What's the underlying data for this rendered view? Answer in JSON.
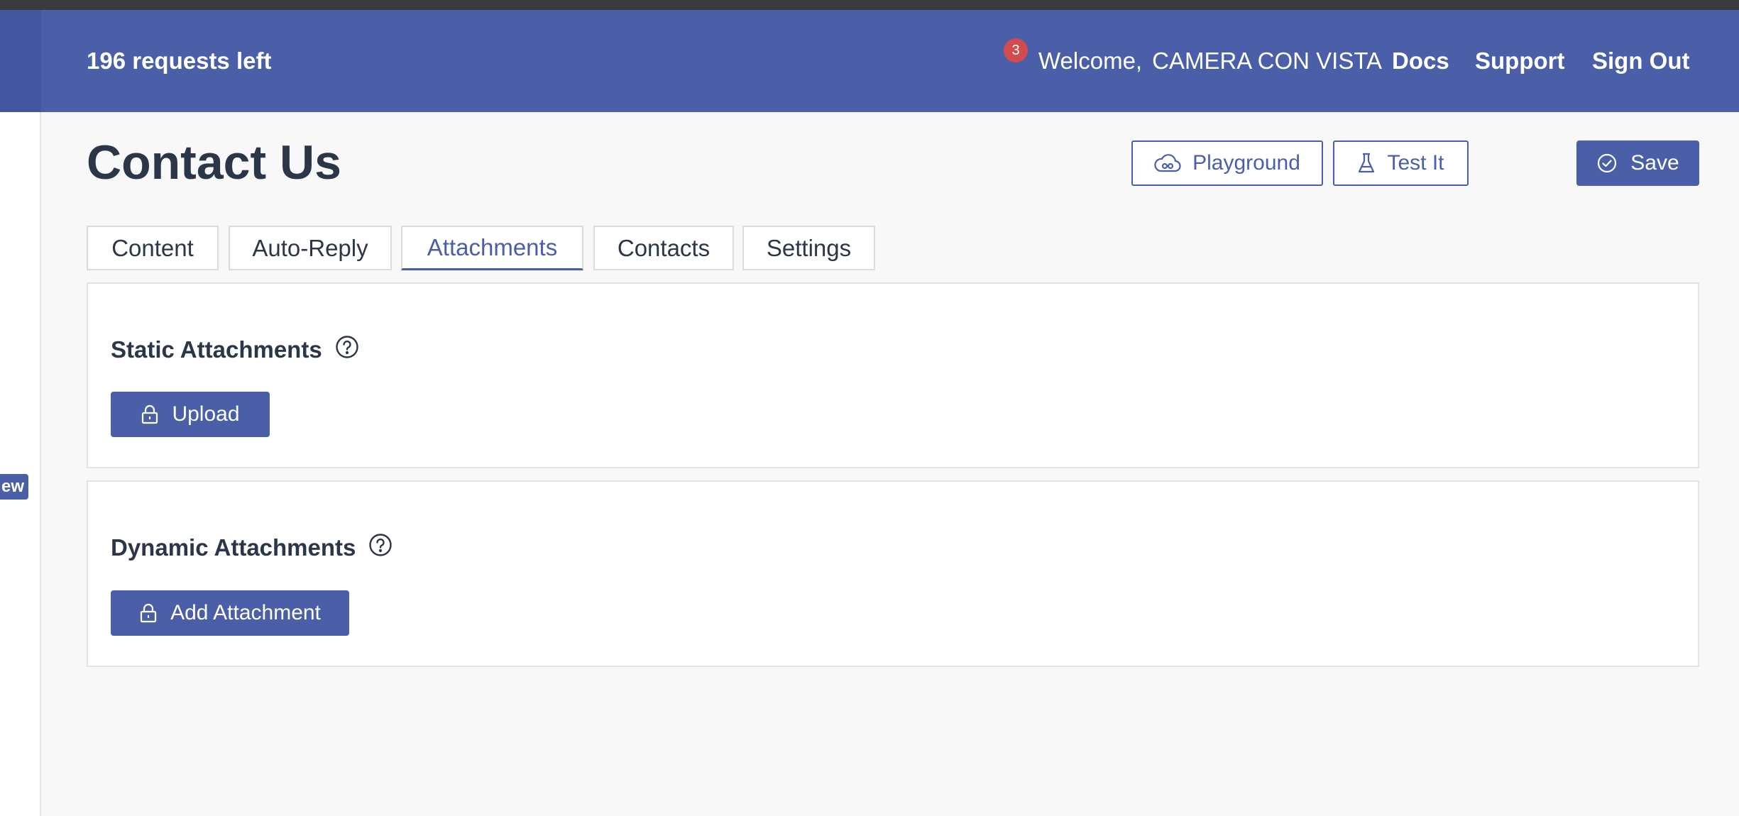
{
  "header": {
    "requests_left": "196 requests left",
    "notification_count": "3",
    "welcome_label": "Welcome,",
    "user_name": "CAMERA CON VISTA",
    "nav": {
      "docs": "Docs",
      "support": "Support",
      "sign_out": "Sign Out"
    }
  },
  "sidebar": {
    "tag_label": "ew"
  },
  "page": {
    "title": "Contact Us",
    "actions": {
      "playground": "Playground",
      "test_it": "Test It",
      "save": "Save"
    }
  },
  "tabs": [
    {
      "label": "Content",
      "active": false
    },
    {
      "label": "Auto-Reply",
      "active": false
    },
    {
      "label": "Attachments",
      "active": true
    },
    {
      "label": "Contacts",
      "active": false
    },
    {
      "label": "Settings",
      "active": false
    }
  ],
  "sections": {
    "static": {
      "title": "Static Attachments",
      "button_label": "Upload"
    },
    "dynamic": {
      "title": "Dynamic Attachments",
      "button_label": "Add Attachment"
    }
  },
  "colors": {
    "brand": "#4b5fa8",
    "badge": "#d24b4f",
    "text": "#2c3649",
    "background": "#f8f8f8"
  },
  "icons": {
    "playground": "cloud-icon",
    "test_it": "flask-icon",
    "save": "check-circle-icon",
    "help": "question-circle-icon",
    "lock": "lock-icon"
  }
}
